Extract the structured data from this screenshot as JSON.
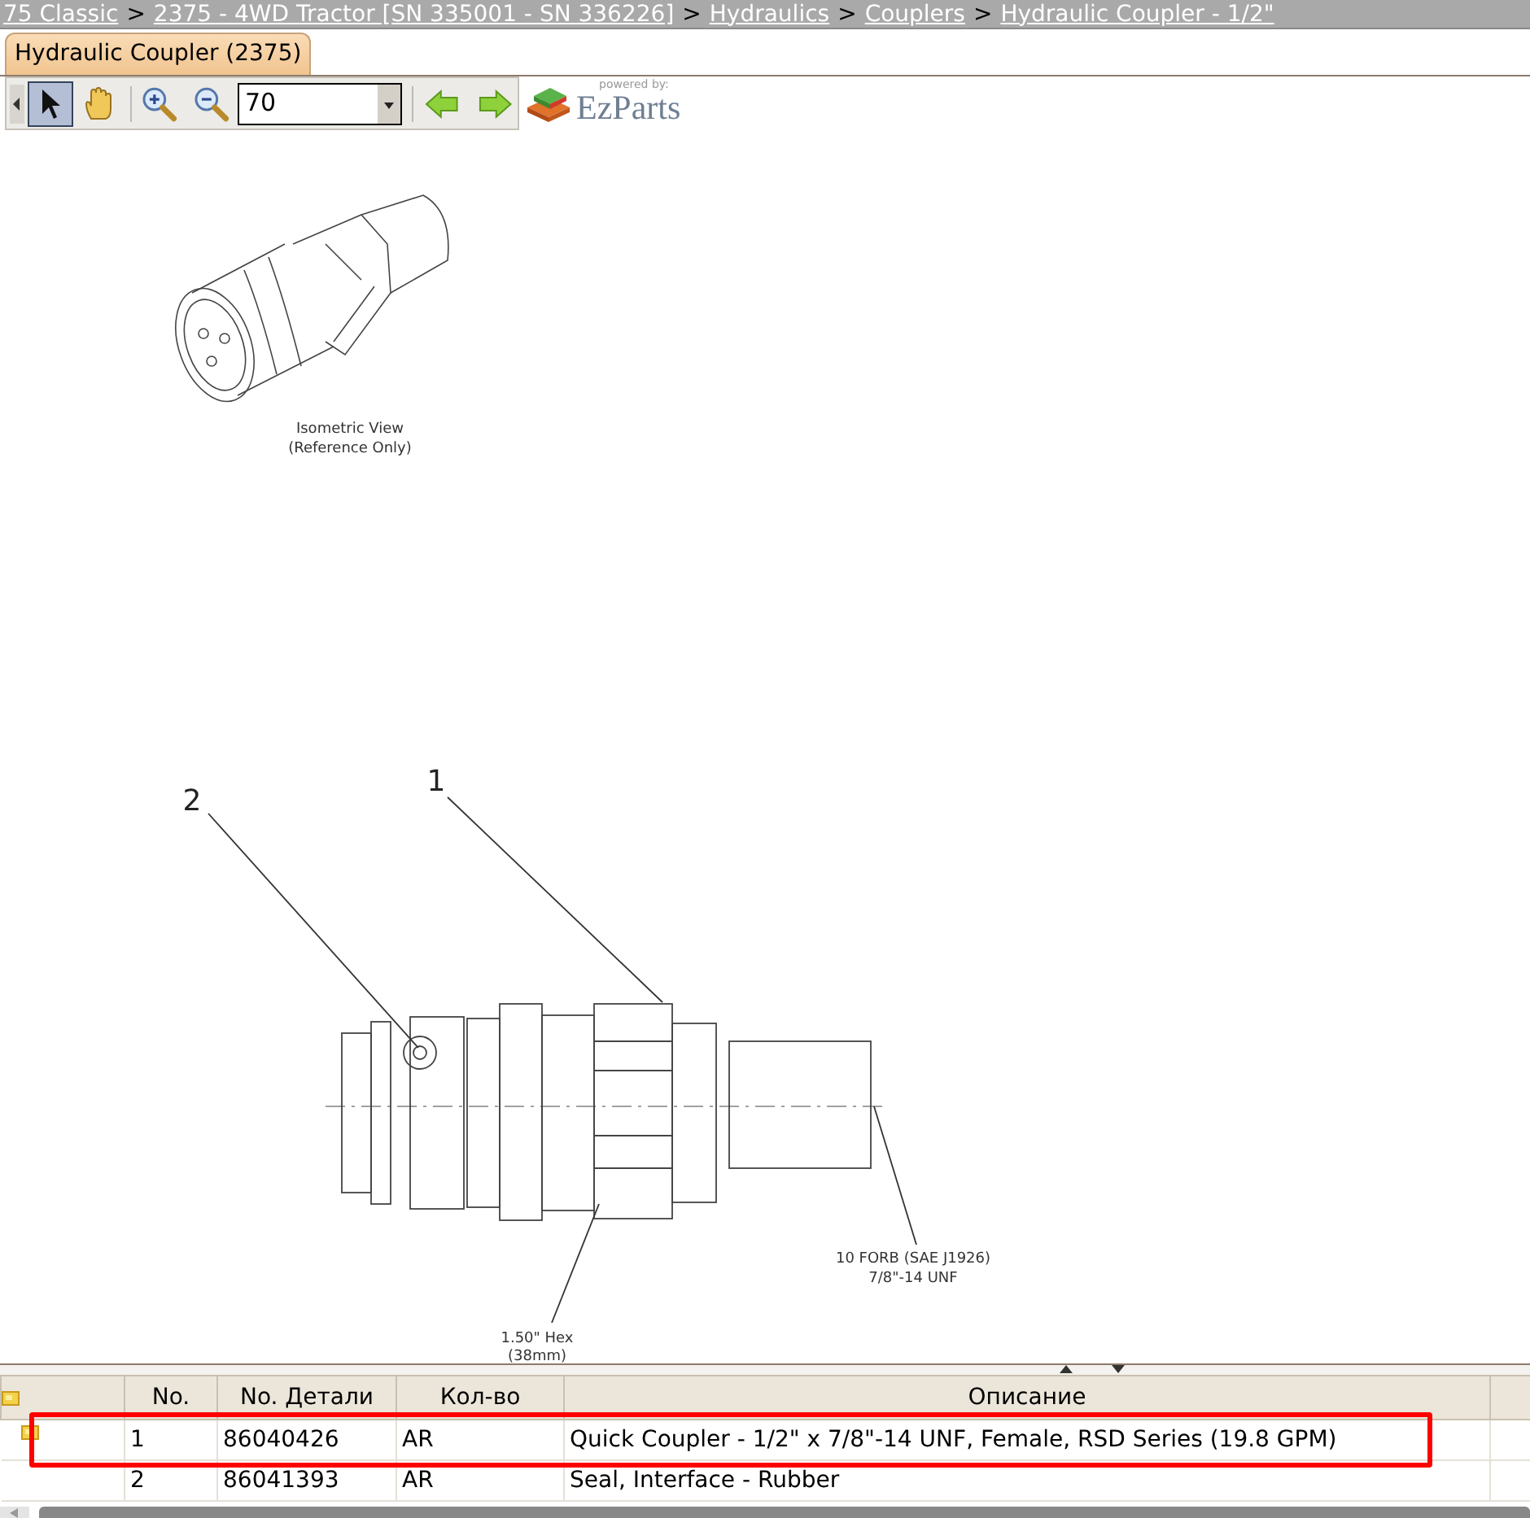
{
  "breadcrumb": [
    {
      "kind": "link",
      "label": "75 Classic"
    },
    {
      "kind": "separator",
      "label": ">"
    },
    {
      "kind": "link",
      "label": "2375 - 4WD Tractor [SN 335001 - SN 336226]"
    },
    {
      "kind": "separator",
      "label": ">"
    },
    {
      "kind": "link",
      "label": "Hydraulics"
    },
    {
      "kind": "separator",
      "label": ">"
    },
    {
      "kind": "link",
      "label": "Couplers"
    },
    {
      "kind": "separator",
      "label": ">"
    },
    {
      "kind": "link",
      "label": "Hydraulic Coupler - 1/2\""
    }
  ],
  "tabs": [
    {
      "label": "Hydraulic Coupler (2375)",
      "selected": true
    }
  ],
  "toolbar": {
    "tools": [
      {
        "kind": "pointer",
        "selected": true
      },
      {
        "kind": "hand",
        "selected": false
      }
    ],
    "zoom_value": "70"
  },
  "logo": {
    "tagline": "powered by:",
    "name": "EzParts"
  },
  "diagram": {
    "iso_caption": [
      "Isometric View",
      "(Reference Only)"
    ],
    "callouts": [
      {
        "label": "1"
      },
      {
        "label": "2"
      }
    ],
    "hex_note": [
      "1.50\" Hex",
      "(38mm)"
    ],
    "port_note": [
      "10 FORB (SAE J1926)",
      "7/8\"-14 UNF"
    ]
  },
  "table": {
    "columns": [
      "No.",
      "No. Детали",
      "Кол-во",
      "Описание"
    ],
    "rows": [
      {
        "has_icon": true,
        "highlighted": true,
        "cells": [
          "1",
          "86040426",
          "AR",
          "Quick Coupler - 1/2\" x 7/8\"-14 UNF, Female, RSD Series (19.8 GPM)"
        ]
      },
      {
        "has_icon": false,
        "highlighted": false,
        "cells": [
          "2",
          "86041393",
          "AR",
          "Seal, Interface - Rubber"
        ]
      }
    ]
  }
}
